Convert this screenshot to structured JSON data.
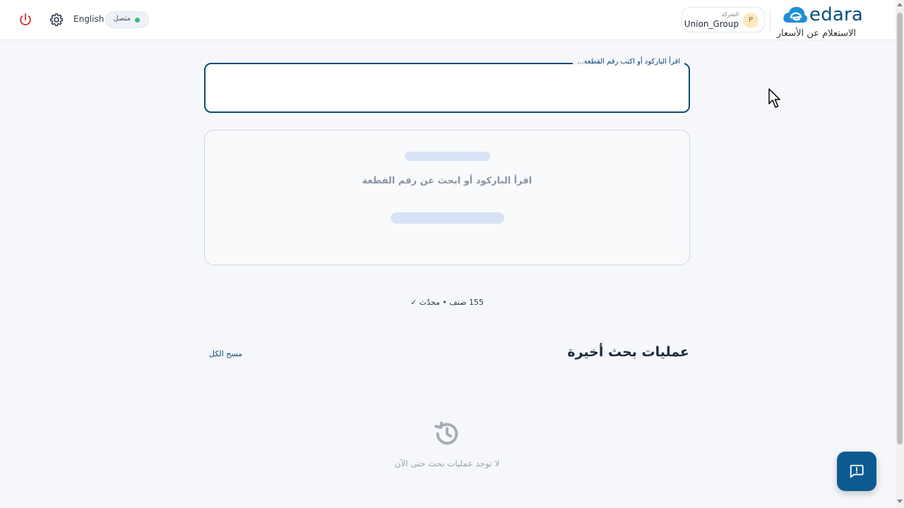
{
  "header": {
    "logo_text": "edara",
    "app_title": "الاستعلام عن الأسعار",
    "company": {
      "label": "الشركة",
      "name": "Union_Group",
      "avatar_letter": "P"
    },
    "status": "متصل",
    "language_button": "English",
    "icons": {
      "settings": "gear-icon",
      "logout": "power-icon"
    }
  },
  "search": {
    "label": "اقرأ الباركود أو اكتب رقم القطعة...",
    "value": ""
  },
  "result": {
    "hint": "اقرأ الباركود أو ابحث عن رقم القطعة"
  },
  "catalog": {
    "summary": "155 صنف • محدّث ✓"
  },
  "recent": {
    "title": "عمليات بحث أخيرة",
    "clear_all": "مسح الكل",
    "empty_text": "لا توجد عمليات بحث حتى الآن"
  },
  "colors": {
    "primary": "#0d4a74",
    "fab": "#0d5a91",
    "status_online": "#2ec27e",
    "power": "#d32f2f"
  }
}
